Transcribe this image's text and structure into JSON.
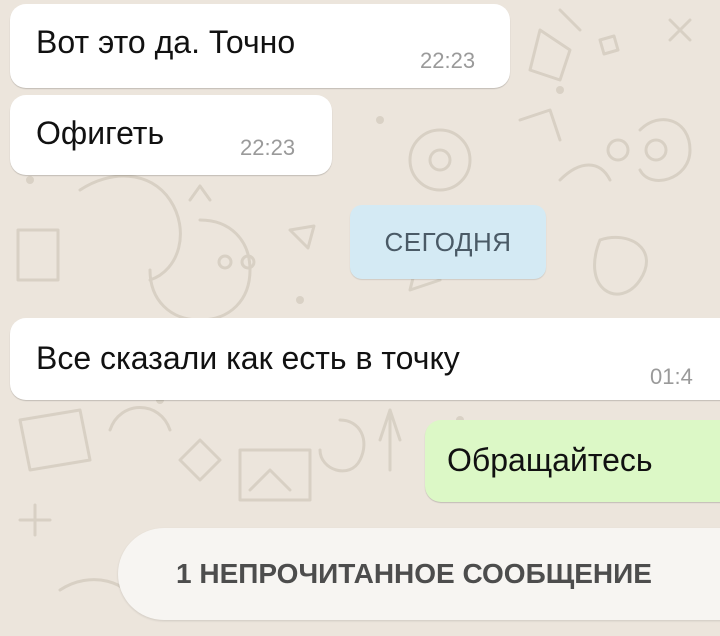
{
  "theme": {
    "wallpaper": "#ECE5DC",
    "incoming_bubble": "#FFFFFF",
    "outgoing_bubble": "#DCF8C6",
    "date_chip": "#D4EAF4"
  },
  "messages": [
    {
      "direction": "incoming",
      "text": "Вот это да. Точно",
      "time": "22:23"
    },
    {
      "direction": "incoming",
      "text": "Офигеть",
      "time": "22:23"
    },
    {
      "direction": "incoming",
      "text": "Все сказали как есть в точку",
      "time": "01:4"
    },
    {
      "direction": "outgoing",
      "text": "Обращайтесь",
      "time": ""
    }
  ],
  "date_separator": {
    "label": "СЕГОДНЯ"
  },
  "unread_banner": {
    "label": "1 НЕПРОЧИТАННОЕ СООБЩЕНИЕ"
  }
}
